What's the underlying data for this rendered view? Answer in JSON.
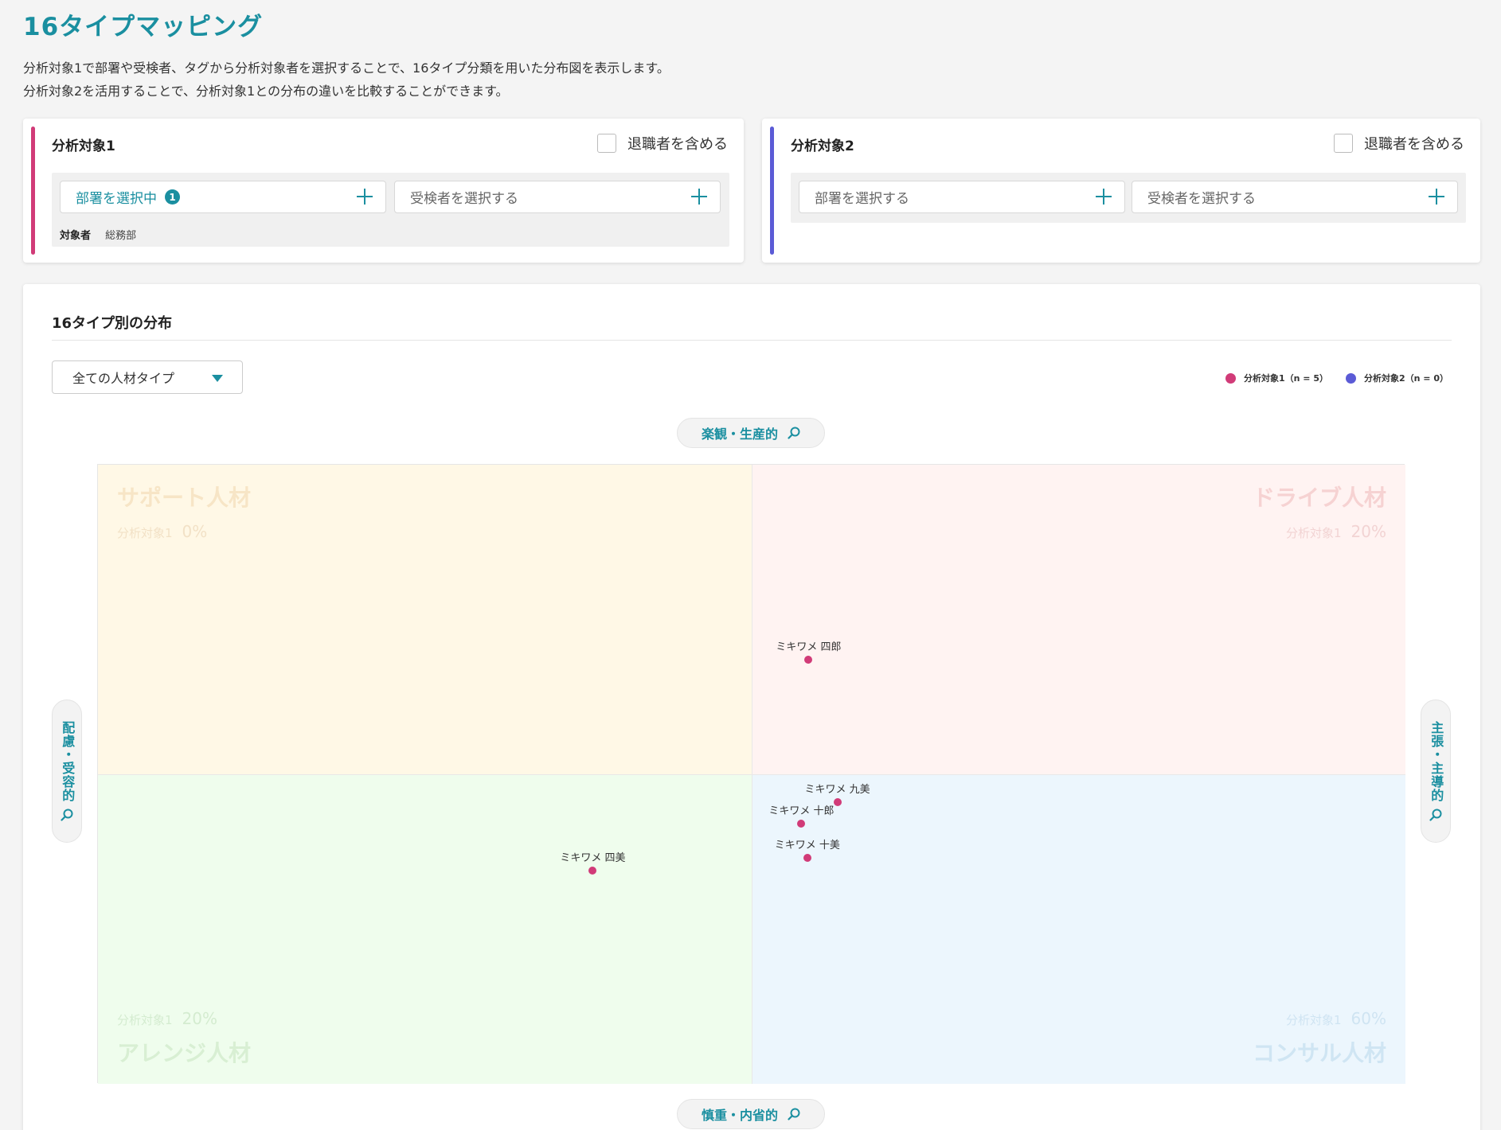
{
  "page": {
    "title": "16タイプマッピング",
    "description_line1": "分析対象1で部署や受検者、タグから分析対象者を選択することで、16タイプ分類を用いた分布図を表示します。",
    "description_line2": "分析対象2を活用することで、分析対象1との分布の違いを比較することができます。"
  },
  "target1": {
    "title": "分析対象1",
    "accent_color": "#d13b78",
    "include_retired_label": "退職者を含める",
    "include_retired_checked": false,
    "department_button": "部署を選択中",
    "department_badge": "1",
    "examinee_button": "受検者を選択する",
    "target_label": "対象者",
    "target_value": "総務部"
  },
  "target2": {
    "title": "分析対象2",
    "accent_color": "#5b5bd6",
    "include_retired_label": "退職者を含める",
    "include_retired_checked": false,
    "department_button": "部署を選択する",
    "examinee_button": "受検者を選択する"
  },
  "distribution": {
    "title": "16タイプ別の分布",
    "type_select_value": "全ての人材タイプ",
    "legend": [
      {
        "label": "分析対象1（n = 5）",
        "color": "#d13b78"
      },
      {
        "label": "分析対象2（n = 0）",
        "color": "#5b5bd6"
      }
    ],
    "axes": {
      "top": "楽観・生産的",
      "bottom": "慎重・内省的",
      "left": "配慮・受容的",
      "right": "主張・主導的"
    },
    "quadrants": {
      "top_left": {
        "name": "サポート人材",
        "target_label": "分析対象1",
        "percent": "0%"
      },
      "top_right": {
        "name": "ドライブ人材",
        "target_label": "分析対象1",
        "percent": "20%"
      },
      "bottom_left": {
        "name": "アレンジ人材",
        "target_label": "分析対象1",
        "percent": "20%"
      },
      "bottom_right": {
        "name": "コンサル人材",
        "target_label": "分析対象1",
        "percent": "60%"
      }
    }
  },
  "chart_data": {
    "type": "scatter",
    "xlim": [
      -1,
      1
    ],
    "ylim": [
      -1,
      1
    ],
    "grid": false,
    "legend_position": "top-right",
    "series": [
      {
        "name": "分析対象1（n = 5）",
        "color": "#d13b78",
        "points": [
          {
            "label": "ミキワメ 四郎",
            "x": 0.087,
            "y": 0.37
          },
          {
            "label": "ミキワメ 九美",
            "x": 0.131,
            "y": -0.09
          },
          {
            "label": "ミキワメ 十郎",
            "x": 0.076,
            "y": -0.16
          },
          {
            "label": "ミキワメ 十美",
            "x": 0.085,
            "y": -0.27
          },
          {
            "label": "ミキワメ 四美",
            "x": -0.243,
            "y": -0.31
          }
        ]
      },
      {
        "name": "分析対象2（n = 0）",
        "color": "#5b5bd6",
        "points": []
      }
    ]
  }
}
